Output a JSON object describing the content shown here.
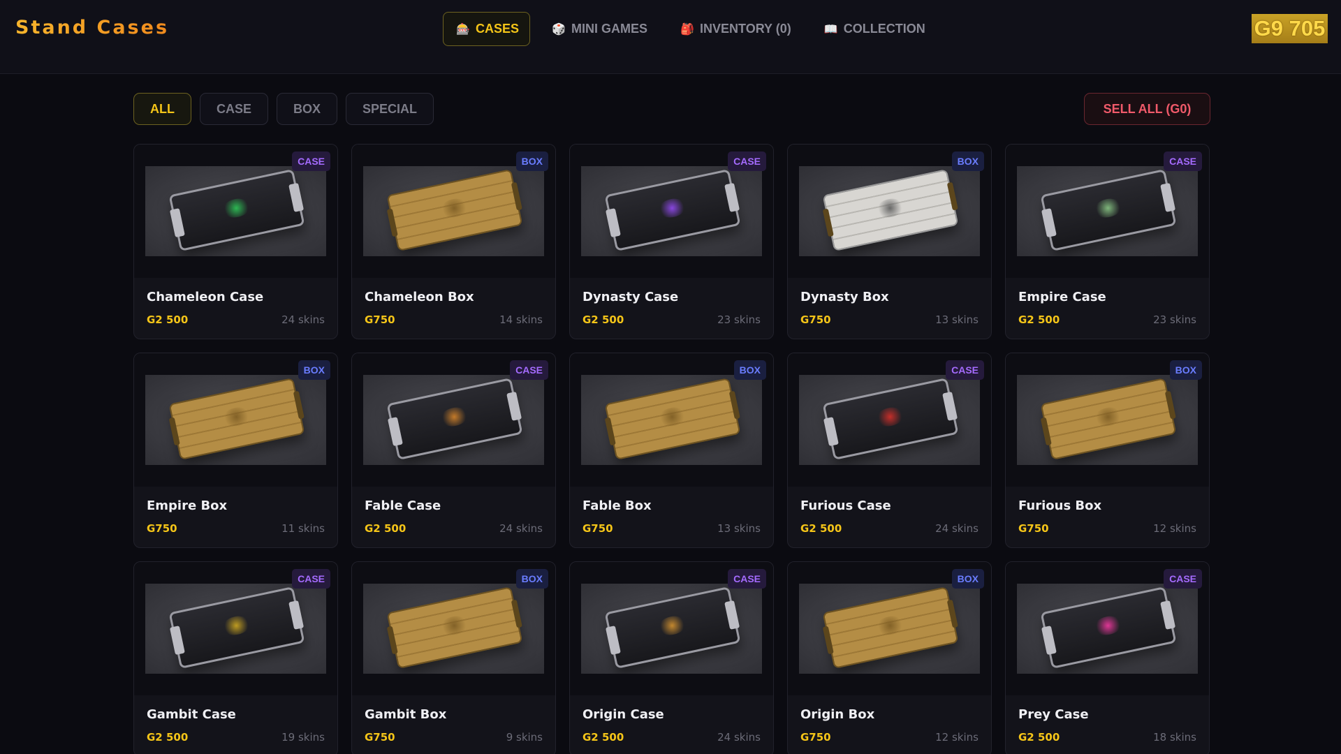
{
  "app": {
    "title": "Stand Cases"
  },
  "nav": [
    {
      "label": "CASES",
      "icon": "🎰",
      "icon_name": "slot-machine-icon",
      "active": true
    },
    {
      "label": "MINI GAMES",
      "icon": "🎲",
      "icon_name": "dice-icon",
      "active": false
    },
    {
      "label": "INVENTORY (0)",
      "icon": "🎒",
      "icon_name": "backpack-icon",
      "active": false
    },
    {
      "label": "COLLECTION",
      "icon": "📖",
      "icon_name": "book-icon",
      "active": false
    }
  ],
  "balance": "G9 705",
  "filters": [
    {
      "label": "ALL",
      "active": true
    },
    {
      "label": "CASE",
      "active": false
    },
    {
      "label": "BOX",
      "active": false
    },
    {
      "label": "SPECIAL",
      "active": false
    }
  ],
  "sell_all_label": "SELL ALL (G0)",
  "colors": {
    "accent": "#f5c518",
    "case_badge": "#a56bff",
    "box_badge": "#6a7dff",
    "sell": "#f05a6a"
  },
  "items": [
    {
      "name": "Chameleon Case",
      "type": "CASE",
      "price": "G2 500",
      "skins": "24 skins",
      "emblem_color": "#2fd15a"
    },
    {
      "name": "Chameleon Box",
      "type": "BOX",
      "price": "G750",
      "skins": "14 skins",
      "emblem_color": "#7a5a22"
    },
    {
      "name": "Dynasty Case",
      "type": "CASE",
      "price": "G2 500",
      "skins": "23 skins",
      "emblem_color": "#9a4dff"
    },
    {
      "name": "Dynasty Box",
      "type": "BOX",
      "price": "G750",
      "skins": "13 skins",
      "emblem_color": "#555555",
      "white": true
    },
    {
      "name": "Empire Case",
      "type": "CASE",
      "price": "G2 500",
      "skins": "23 skins",
      "emblem_color": "#8fd08a"
    },
    {
      "name": "Empire Box",
      "type": "BOX",
      "price": "G750",
      "skins": "11 skins",
      "emblem_color": "#7a5a22"
    },
    {
      "name": "Fable Case",
      "type": "CASE",
      "price": "G2 500",
      "skins": "24 skins",
      "emblem_color": "#e08a2a"
    },
    {
      "name": "Fable Box",
      "type": "BOX",
      "price": "G750",
      "skins": "13 skins",
      "emblem_color": "#7a5a22"
    },
    {
      "name": "Furious Case",
      "type": "CASE",
      "price": "G2 500",
      "skins": "24 skins",
      "emblem_color": "#e0302a"
    },
    {
      "name": "Furious Box",
      "type": "BOX",
      "price": "G750",
      "skins": "12 skins",
      "emblem_color": "#7a5a22"
    },
    {
      "name": "Gambit Case",
      "type": "CASE",
      "price": "G2 500",
      "skins": "19 skins",
      "emblem_color": "#d9b020"
    },
    {
      "name": "Gambit Box",
      "type": "BOX",
      "price": "G750",
      "skins": "9 skins",
      "emblem_color": "#7a5a22"
    },
    {
      "name": "Origin Case",
      "type": "CASE",
      "price": "G2 500",
      "skins": "24 skins",
      "emblem_color": "#e09a30"
    },
    {
      "name": "Origin Box",
      "type": "BOX",
      "price": "G750",
      "skins": "12 skins",
      "emblem_color": "#7a5a22"
    },
    {
      "name": "Prey Case",
      "type": "CASE",
      "price": "G2 500",
      "skins": "18 skins",
      "emblem_color": "#ff3aa8"
    }
  ]
}
